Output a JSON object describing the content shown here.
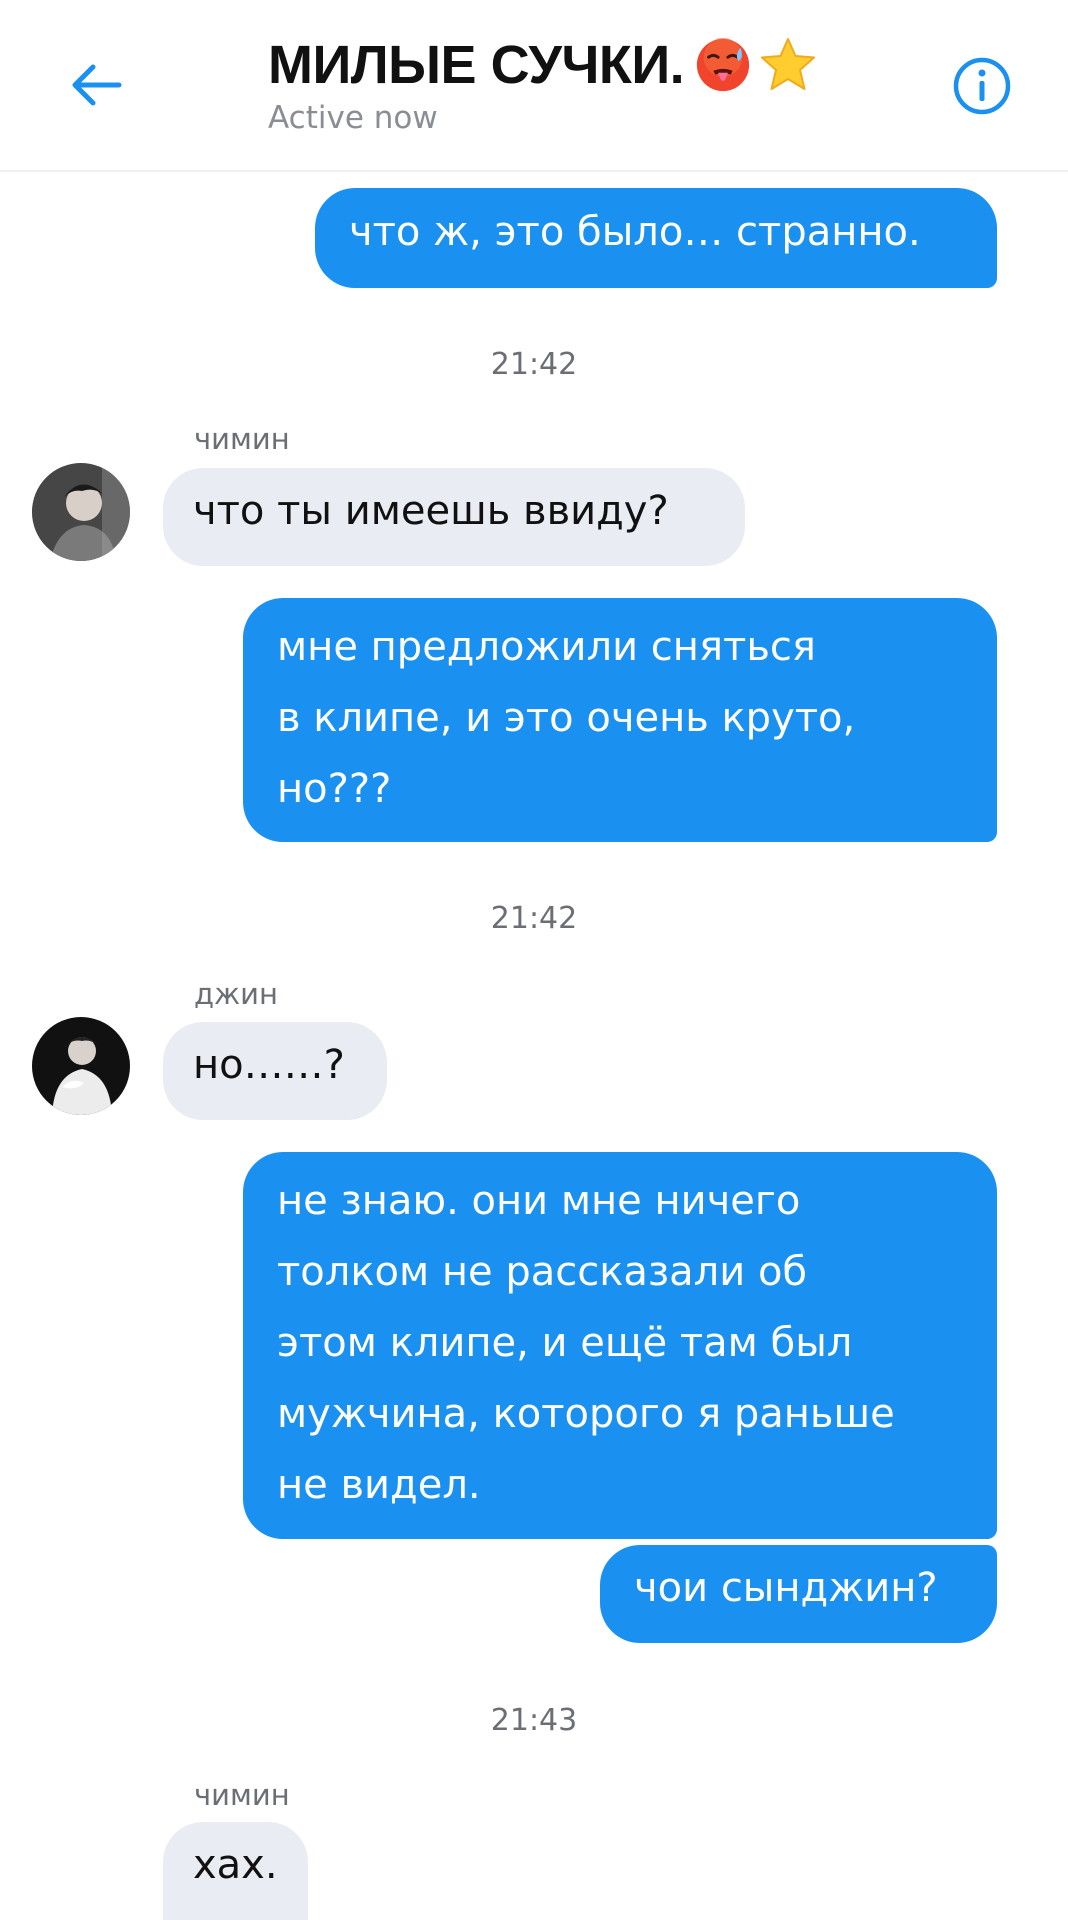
{
  "header": {
    "title": "МИЛЫЕ СУЧКИ.",
    "title_emojis": [
      "hot-face-emoji",
      "star-emoji"
    ],
    "status": "Active now",
    "accent_color": "#1a90f0",
    "back_icon": "arrow-left-icon",
    "info_icon": "info-circle-icon"
  },
  "messages": {
    "m1": "что ж, это было… странно.",
    "ts1": "21:42",
    "sender1": "чимин",
    "m2": "что ты имеешь ввиду?",
    "m3": [
      "мне предложили сняться",
      "в клипе, и это очень круто,",
      "но???"
    ],
    "ts2": "21:42",
    "sender2": "джин",
    "m4": "но……?",
    "m5": [
      "не знаю. они мне ничего",
      "толком не рассказали об",
      "этом клипе, и ещё там был",
      "мужчина, которого я раньше",
      "не видел."
    ],
    "m6": "чои сынджин?",
    "ts3": "21:43",
    "sender3": "чимин",
    "m7": "хах."
  },
  "colors": {
    "outgoing_bubble": "#1a90f0",
    "incoming_bubble": "#e9ecf3"
  }
}
